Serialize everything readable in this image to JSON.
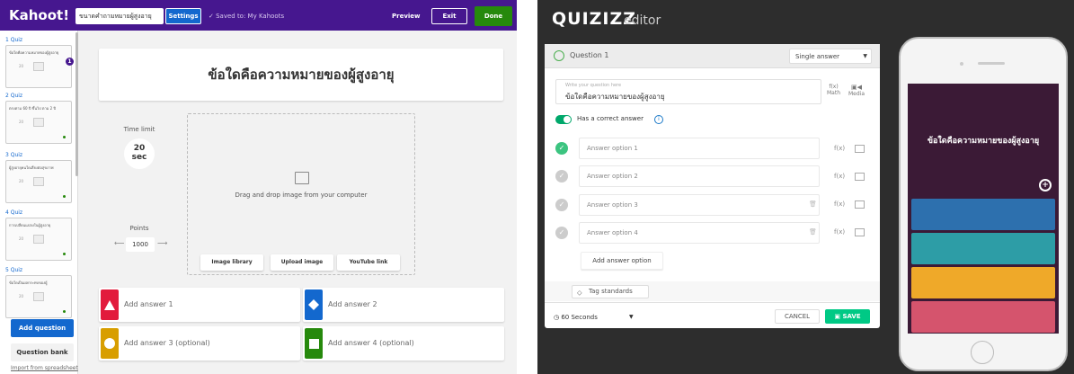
{
  "kahoot": {
    "logo": "Kahoot!",
    "title_value": "ขนาดคำถามหมายผู้สูงอายุ",
    "settings_label": "Settings",
    "saved_label": "✓  Saved to: My Kahoots",
    "preview_label": "Preview",
    "exit_label": "Exit",
    "done_label": "Done",
    "slides": [
      {
        "label": "1  Quiz",
        "text": "ข้อใดคือความหมายของผู้สูงอายุ",
        "num": "20",
        "badge": "1"
      },
      {
        "label": "2  Quiz",
        "text": "ตรงตาม 60 ปี ขึ้นไป ตาม 2 ปี",
        "num": "20",
        "badge": ""
      },
      {
        "label": "3  Quiz",
        "text": "ผู้สูงอายุคนใดเสี่ยงต่อสุขภาพ",
        "num": "20",
        "badge": ""
      },
      {
        "label": "4  Quiz",
        "text": "การเปลี่ยนแปลงในผู้สูงอายุ",
        "num": "20",
        "badge": ""
      },
      {
        "label": "5  Quiz",
        "text": "ข้อใดเป็นผลกระทบของผู้",
        "num": "20",
        "badge": ""
      }
    ],
    "add_question_label": "Add question",
    "question_bank_label": "Question bank",
    "import_label": "Import from spreadsheet",
    "question_text": "ข้อใดคือความหมายของผู้สูงอายุ",
    "time_limit_label": "Time limit",
    "time_value": "20",
    "time_unit": "sec",
    "points_label": "Points",
    "points_value": "1000",
    "drop_text": "Drag and drop image from your computer",
    "image_library_label": "Image library",
    "upload_image_label": "Upload image",
    "youtube_label": "YouTube link",
    "answers": [
      {
        "text": "Add answer 1",
        "color": "#e21b3c",
        "shape": "triangle"
      },
      {
        "text": "Add answer 2",
        "color": "#1368ce",
        "shape": "diamond"
      },
      {
        "text": "Add answer 3 (optional)",
        "color": "#d89e00",
        "shape": "circle"
      },
      {
        "text": "Add answer 4 (optional)",
        "color": "#26890c",
        "shape": "square"
      }
    ]
  },
  "quizizz": {
    "brand": "QUIZIZZ",
    "brand_sub": "editor",
    "question_label": "Question 1",
    "type_label": "Single answer",
    "question_placeholder": "Write your question here",
    "question_text": "ข้อใดคือความหมายของผู้สูงอายุ",
    "math_label": "Math",
    "media_label": "Media",
    "fx_label": "f(x)",
    "correct_label": "Has a correct answer",
    "info_icon": "i",
    "options": [
      {
        "text": "Answer option 1",
        "correct": true
      },
      {
        "text": "Answer option 2",
        "correct": false
      },
      {
        "text": "Answer option 3",
        "correct": false
      },
      {
        "text": "Answer option 4",
        "correct": false
      }
    ],
    "add_option_label": "Add answer option",
    "tag_label": "Tag standards",
    "time_label": "60 Seconds",
    "cancel_label": "CANCEL",
    "save_label": "SAVE",
    "preview_question": "ข้อใดคือความหมายของผู้สูงอายุ",
    "preview_colors": [
      "#2d70ae",
      "#2d9da6",
      "#efa929",
      "#d5546d"
    ]
  }
}
